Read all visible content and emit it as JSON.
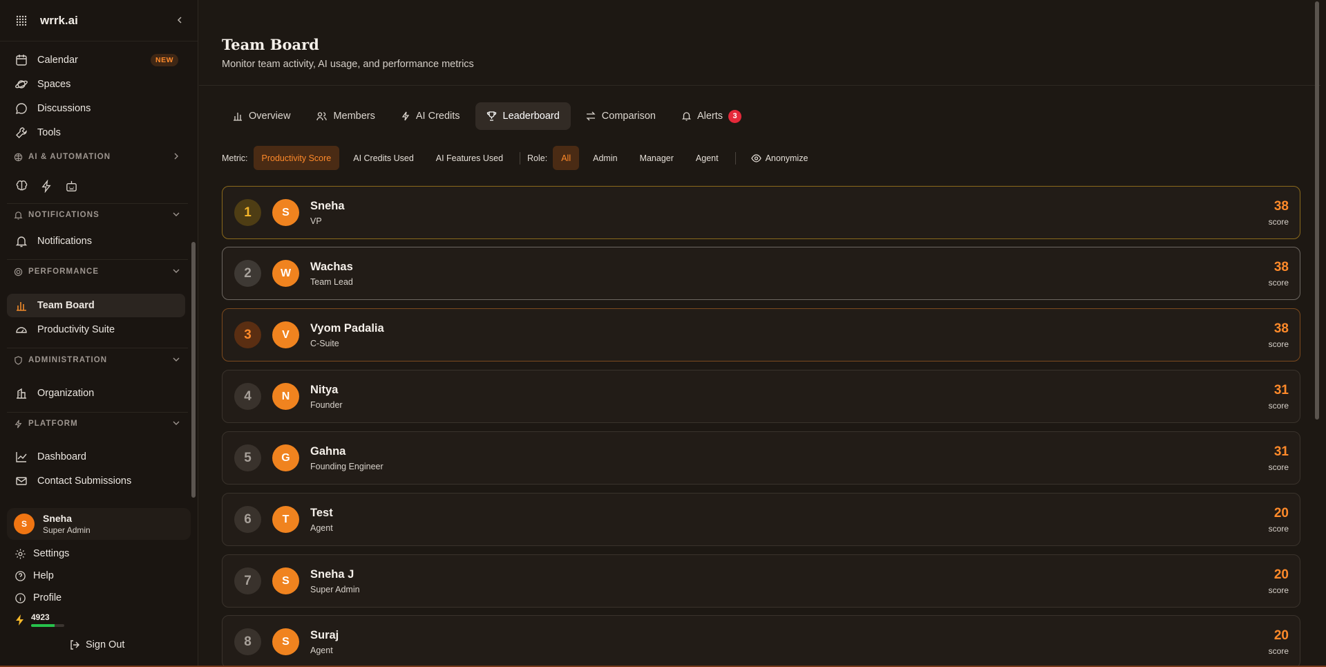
{
  "app": {
    "name": "wrrk.ai"
  },
  "sidebar": {
    "items_top": [
      {
        "label": "Calendar",
        "badge": "NEW",
        "icon": "calendar-icon"
      },
      {
        "label": "Spaces",
        "icon": "planet-icon"
      },
      {
        "label": "Discussions",
        "icon": "chat-bubble-icon"
      },
      {
        "label": "Tools",
        "icon": "wrench-icon"
      }
    ],
    "sections": {
      "ai": "AI & AUTOMATION",
      "notifications": "NOTIFICATIONS",
      "performance": "PERFORMANCE",
      "administration": "ADMINISTRATION",
      "platform": "PLATFORM"
    },
    "notifications_item": "Notifications",
    "performance_items": [
      "Team Board",
      "Productivity Suite"
    ],
    "admin_items": [
      "Organization"
    ],
    "platform_items": [
      "Dashboard",
      "Contact Submissions"
    ],
    "user": {
      "initial": "S",
      "name": "Sneha",
      "role": "Super Admin"
    },
    "bottom": [
      "Settings",
      "Help",
      "Profile"
    ],
    "credits": {
      "value": "4923",
      "fraction": 0.7
    },
    "signout": "Sign Out"
  },
  "header": {
    "title": "Team Board",
    "subtitle": "Monitor team activity, AI usage, and performance metrics"
  },
  "tabs": [
    {
      "label": "Overview"
    },
    {
      "label": "Members"
    },
    {
      "label": "AI Credits"
    },
    {
      "label": "Leaderboard",
      "active": true
    },
    {
      "label": "Comparison"
    },
    {
      "label": "Alerts",
      "count": "3"
    }
  ],
  "filters": {
    "metric_label": "Metric:",
    "metrics": [
      "Productivity Score",
      "AI Credits Used",
      "AI Features Used"
    ],
    "role_label": "Role:",
    "roles": [
      "All",
      "Admin",
      "Manager",
      "Agent"
    ],
    "anonymize": "Anonymize"
  },
  "leaderboard": [
    {
      "rank": "1",
      "initial": "S",
      "name": "Sneha",
      "role": "VP",
      "score": "38",
      "score_label": "score"
    },
    {
      "rank": "2",
      "initial": "W",
      "name": "Wachas",
      "role": "Team Lead",
      "score": "38",
      "score_label": "score"
    },
    {
      "rank": "3",
      "initial": "V",
      "name": "Vyom Padalia",
      "role": "C-Suite",
      "score": "38",
      "score_label": "score"
    },
    {
      "rank": "4",
      "initial": "N",
      "name": "Nitya",
      "role": "Founder",
      "score": "31",
      "score_label": "score"
    },
    {
      "rank": "5",
      "initial": "G",
      "name": "Gahna",
      "role": "Founding Engineer",
      "score": "31",
      "score_label": "score"
    },
    {
      "rank": "6",
      "initial": "T",
      "name": "Test",
      "role": "Agent",
      "score": "20",
      "score_label": "score"
    },
    {
      "rank": "7",
      "initial": "S",
      "name": "Sneha J",
      "role": "Super Admin",
      "score": "20",
      "score_label": "score"
    },
    {
      "rank": "8",
      "initial": "S",
      "name": "Suraj",
      "role": "Agent",
      "score": "20",
      "score_label": "score"
    }
  ],
  "colors": {
    "accent": "#ff8a2a",
    "gold": "#f4b52a",
    "alert": "#e5293a",
    "credits_bar": "#27c24c"
  }
}
